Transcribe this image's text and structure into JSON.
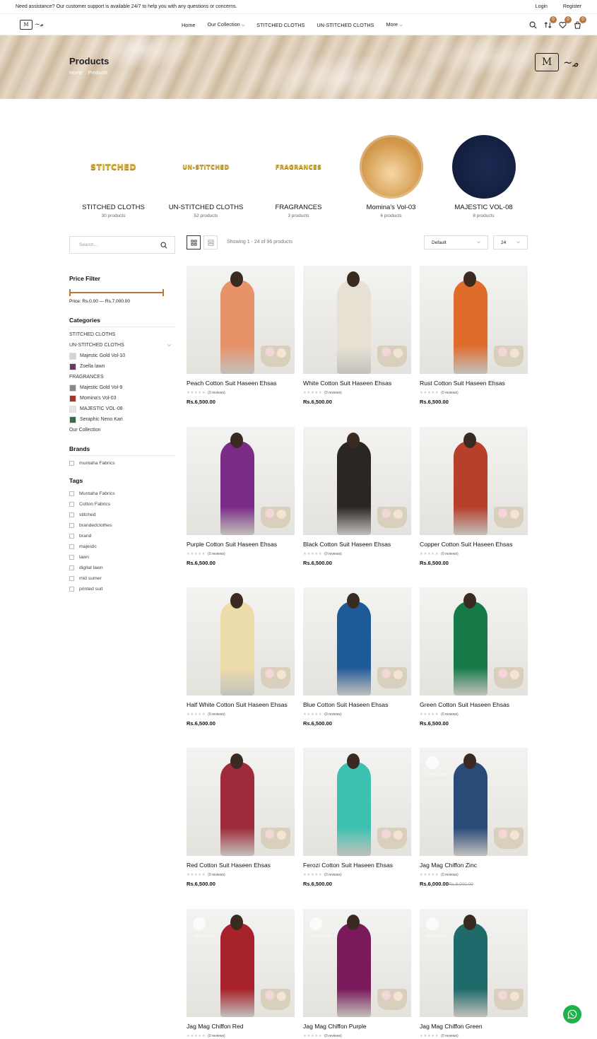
{
  "topbar": {
    "notice": "Need assistance? Our customer support is available 24/7 to help you with any questions or concerns.",
    "login": "Login",
    "register": "Register"
  },
  "nav": {
    "items": [
      "Home",
      "Our Collection",
      "STITCHED CLOTHS",
      "UN-STITCHED CLOTHS",
      "More"
    ],
    "compare_count": "0",
    "wishlist_count": "0",
    "cart_count": "0"
  },
  "hero": {
    "title": "Products",
    "crumb_home": "Home",
    "crumb_current": "Products"
  },
  "categories": [
    {
      "name": "STITCHED CLOTHS",
      "count": "30 products",
      "image_word": "STITCHED"
    },
    {
      "name": "UN-STITCHED CLOTHS",
      "count": "52 products",
      "image_word": "UN-STITCHED"
    },
    {
      "name": "FRAGRANCES",
      "count": "3 products",
      "image_word": "FRAGRANCES"
    },
    {
      "name": "Momina's Vol-03",
      "count": "6 products"
    },
    {
      "name": "MAJESTIC VOL-08",
      "count": "8 products"
    }
  ],
  "sidebar": {
    "search_placeholder": "Search...",
    "price_filter_title": "Price Filter",
    "price_label": "Price: Rs.0.00 — Rs.7,000.00",
    "categories_title": "Categories",
    "category_items": [
      "STITCHED CLOTHS",
      "UN-STITCHED CLOTHS",
      "Majestic Gold Vol-10",
      "Zoella lawn",
      "FRAGRANCES",
      "Majestic Gold Vol-9",
      "Momina's Vol-03",
      "MAJESTIC VOL-08",
      "Seraphic Neno Kari",
      "Our Collection"
    ],
    "brands_title": "Brands",
    "brands": [
      "muntaha Fabrics"
    ],
    "tags_title": "Tags",
    "tags": [
      "Muntaha Fabrics",
      "Cotton Fabrics",
      "stitched",
      "brandedclothes",
      "brand",
      "majestic",
      "lawn",
      "digital lawn",
      "mid sumer",
      "printed suit"
    ]
  },
  "toolbar": {
    "showing": "Showing 1 - 24 of 96 products",
    "sort_value": "Default",
    "per_page_value": "24"
  },
  "products": [
    {
      "title": "Peach Cotton Suit Haseen Ehsas",
      "reviews": "(0 reviews)",
      "price": "Rs.6,500.00",
      "color": "#e8926a"
    },
    {
      "title": "White Cotton Suit Haseen Ehsas",
      "reviews": "(0 reviews)",
      "price": "Rs.6,500.00",
      "color": "#e7e1d3"
    },
    {
      "title": "Rust Cotton Suit Haseen Ehsas",
      "reviews": "(0 reviews)",
      "price": "Rs.6,500.00",
      "color": "#e06c2c"
    },
    {
      "title": "Purple Cotton Suit Haseen Ehsas",
      "reviews": "(0 reviews)",
      "price": "Rs.6,500.00",
      "color": "#7a2c86"
    },
    {
      "title": "Black Cotton Suit Haseen Ehsas",
      "reviews": "(0 reviews)",
      "price": "Rs.6,500.00",
      "color": "#2a2622"
    },
    {
      "title": "Copper Cotton Suit Haseen Ehsas",
      "reviews": "(0 reviews)",
      "price": "Rs.6,500.00",
      "color": "#b6402a"
    },
    {
      "title": "Half White Cotton Suit Haseen Ehsas",
      "reviews": "(0 reviews)",
      "price": "Rs.6,500.00",
      "color": "#ecdcaa"
    },
    {
      "title": "Blue Cotton Suit Haseen Ehsas",
      "reviews": "(0 reviews)",
      "price": "Rs.6,500.00",
      "color": "#1f5a98"
    },
    {
      "title": "Green Cotton Suit Haseen Ehsas",
      "reviews": "(0 reviews)",
      "price": "Rs.6,500.00",
      "color": "#157a48"
    },
    {
      "title": "Red Cotton Suit Haseen Ehsas",
      "reviews": "(0 reviews)",
      "price": "Rs.6,500.00",
      "color": "#9e2a3a"
    },
    {
      "title": "Ferozi Cotton Suit Haseen Ehsas",
      "reviews": "(0 reviews)",
      "price": "Rs.6,500.00",
      "color": "#3cc1b0"
    },
    {
      "title": "Jag Mag Chiffon Zinc",
      "reviews": "(0 reviews)",
      "price": "Rs.6,000.00",
      "old_price": "Rs.8,000.00",
      "color": "#2a4a78",
      "badge": "STITCHED"
    },
    {
      "title": "Jag Mag Chiffon Red",
      "reviews": "(0 reviews)",
      "price": "",
      "color": "#a8222c",
      "badge": "STITCHED"
    },
    {
      "title": "Jag Mag Chiffon Purple",
      "reviews": "(0 reviews)",
      "price": "",
      "color": "#7a1a5a",
      "badge": "STITCHED"
    },
    {
      "title": "Jag Mag Chiffon Green",
      "reviews": "(0 reviews)",
      "price": "",
      "color": "#1f6a6a",
      "badge": "STITCHED"
    }
  ],
  "colors": {
    "accent": "#b8793f",
    "whatsapp": "#1fb24a"
  }
}
